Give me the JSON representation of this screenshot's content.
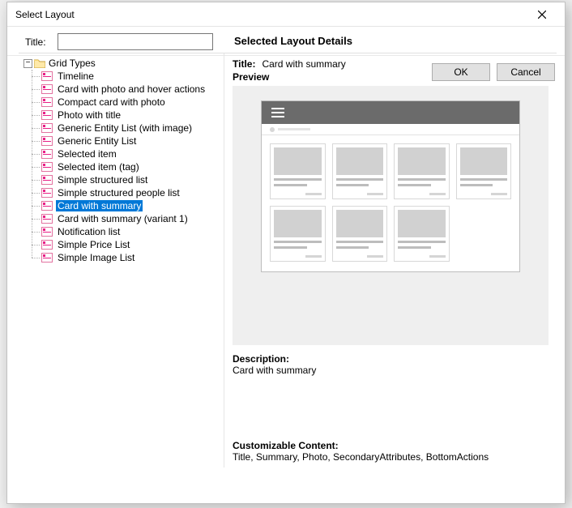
{
  "window": {
    "title": "Select Layout"
  },
  "form": {
    "title_label": "Title:",
    "title_value": ""
  },
  "tree": {
    "root_label": "Grid Types",
    "items": [
      {
        "label": "Timeline"
      },
      {
        "label": "Card with photo and hover actions"
      },
      {
        "label": "Compact card with photo"
      },
      {
        "label": "Photo with title"
      },
      {
        "label": "Generic Entity List (with image)"
      },
      {
        "label": "Generic Entity List"
      },
      {
        "label": "Selected item"
      },
      {
        "label": "Selected item (tag)"
      },
      {
        "label": "Simple structured list"
      },
      {
        "label": "Simple structured people list"
      },
      {
        "label": "Card with summary",
        "selected": true
      },
      {
        "label": "Card with summary (variant 1)"
      },
      {
        "label": "Notification list"
      },
      {
        "label": "Simple Price List"
      },
      {
        "label": "Simple Image List"
      }
    ]
  },
  "details": {
    "heading": "Selected Layout Details",
    "title_label": "Title:",
    "title_value": "Card with summary",
    "preview_label": "Preview",
    "description_label": "Description:",
    "description_value": "Card with summary",
    "customizable_label": "Customizable Content:",
    "customizable_value": "Title, Summary, Photo, SecondaryAttributes, BottomActions"
  },
  "buttons": {
    "ok": "OK",
    "cancel": "Cancel"
  }
}
